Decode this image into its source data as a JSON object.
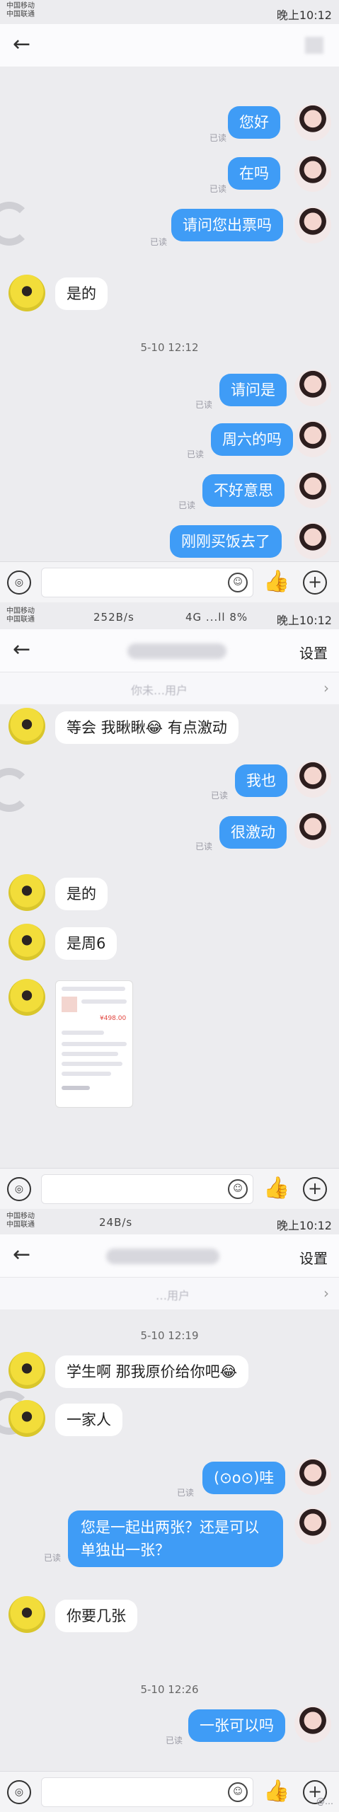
{
  "status": {
    "carrier_line1": "中国移动",
    "carrier_line2": "中国联通",
    "net_speed": "252B/s",
    "signal": "4G ...ll 8%",
    "time": "晚上10:12",
    "net_speed_p3": "24B/s"
  },
  "nav": {
    "settings_label": "设置",
    "subbar_text": "你未…用户",
    "subbar_text_p3": "…用户"
  },
  "panel1": {
    "messages": [
      {
        "dir": "out",
        "text": "您好",
        "read": "已读"
      },
      {
        "dir": "out",
        "text": "在吗",
        "read": "已读"
      },
      {
        "dir": "out",
        "text": "请问您出票吗",
        "read": "已读"
      },
      {
        "dir": "in",
        "text": "是的"
      },
      {
        "dir": "out",
        "text": "请问是",
        "read": "已读"
      },
      {
        "dir": "out",
        "text": "周六的吗",
        "read": "已读"
      },
      {
        "dir": "out",
        "text": "不好意思",
        "read": "已读"
      },
      {
        "dir": "out",
        "text": "刚刚买饭去了"
      }
    ],
    "timestamp": "5-10 12:12"
  },
  "panel2": {
    "messages": [
      {
        "dir": "in",
        "text": "等会 我瞅瞅😂 有点激动"
      },
      {
        "dir": "out",
        "text": "我也",
        "read": "已读"
      },
      {
        "dir": "out",
        "text": "很激动",
        "read": "已读"
      },
      {
        "dir": "in",
        "text": "是的"
      },
      {
        "dir": "in",
        "text": "是周6"
      }
    ],
    "screenshot_price": "¥498.00"
  },
  "panel3": {
    "timestamp1": "5-10 12:19",
    "timestamp2": "5-10 12:26",
    "messages": [
      {
        "dir": "in",
        "text": "学生啊 那我原价给你吧😂"
      },
      {
        "dir": "in",
        "text": "一家人"
      },
      {
        "dir": "out",
        "text": "(⊙o⊙)哇",
        "read": "已读"
      },
      {
        "dir": "out",
        "text": "您是一起出两张？还是可以单独出一张？",
        "read": "已读"
      },
      {
        "dir": "in",
        "text": "你要几张"
      },
      {
        "dir": "out",
        "text": "一张可以吗",
        "read": "已读"
      }
    ],
    "watermark": "@…"
  },
  "input": {
    "voice_icon": "voice-icon",
    "emoji_icon": "emoji-icon",
    "like_icon": "thumbs-up-icon",
    "plus_icon": "plus-icon"
  },
  "colors": {
    "bubble_out": "#3f9cf6",
    "bubble_in": "#ffffff",
    "background": "#ececef"
  }
}
